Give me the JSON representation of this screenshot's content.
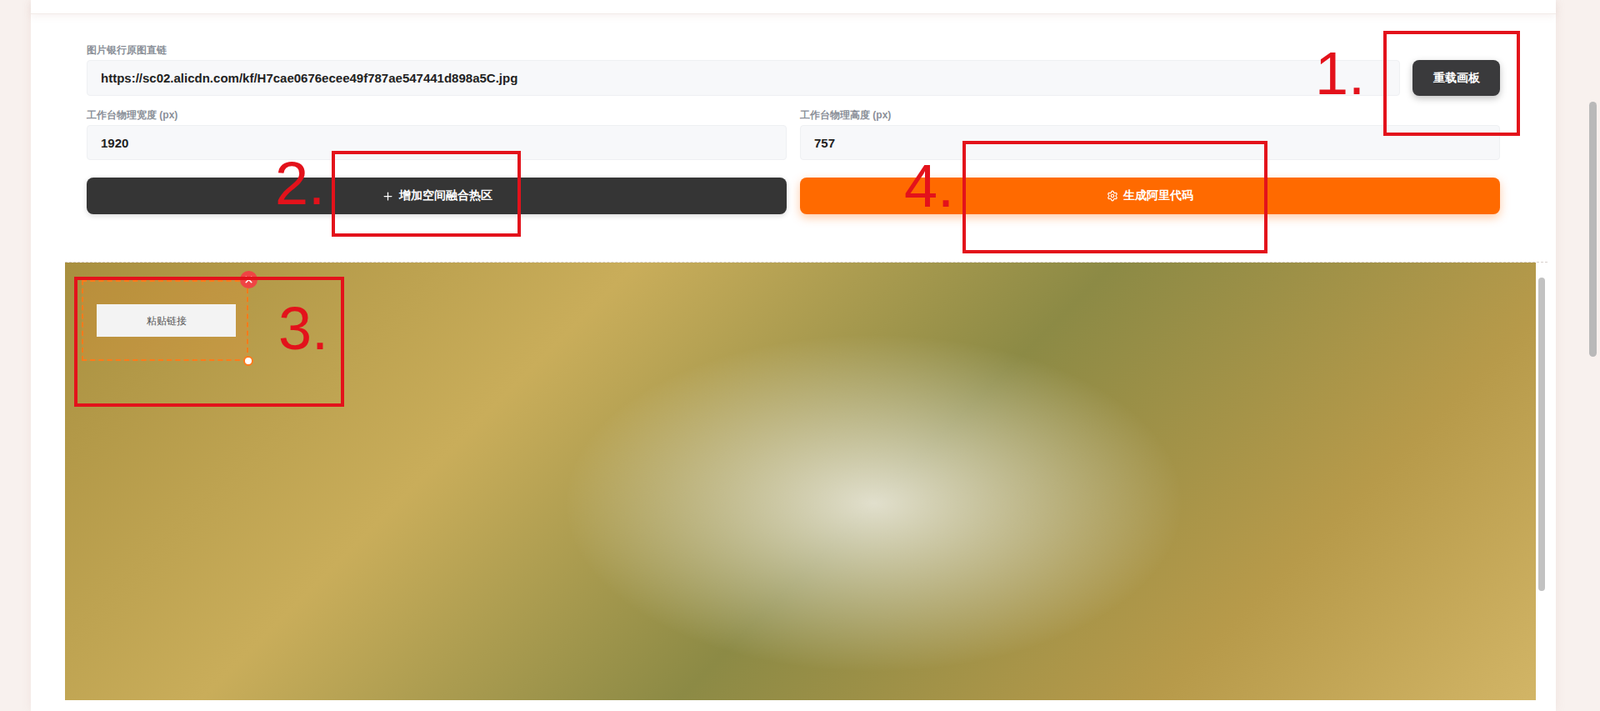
{
  "source_image": {
    "label": "图片银行原图直链",
    "value": "https://sc02.alicdn.com/kf/H7cae0676ecee49f787ae547441d898a5C.jpg"
  },
  "reload_button": {
    "label": "重载画板"
  },
  "dimensions": [
    {
      "label": "工作台物理宽度 (px)",
      "value": "1920"
    },
    {
      "label": "工作台物理高度 (px)",
      "value": "757"
    }
  ],
  "actions": [
    {
      "label": "增加空间融合热区",
      "kind": "secondary"
    },
    {
      "label": "生成阿里代码",
      "kind": "primary"
    }
  ],
  "canvas": {
    "hotspots": [
      {
        "placeholder": "粘贴链接",
        "selected": true
      }
    ]
  },
  "annotations": [
    {
      "label": "1."
    },
    {
      "label": "2."
    },
    {
      "label": "3."
    },
    {
      "label": "4."
    }
  ]
}
